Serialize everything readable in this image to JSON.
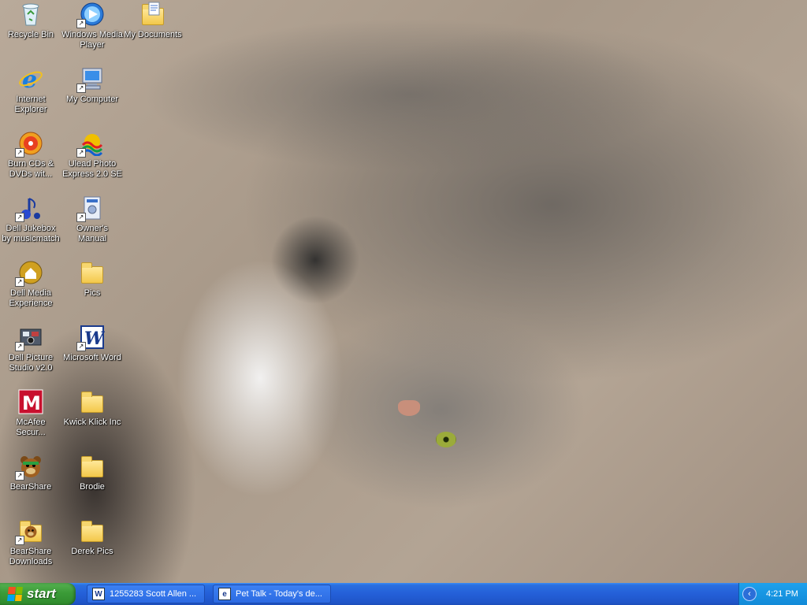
{
  "desktop": {
    "icons": [
      {
        "label": "Recycle Bin",
        "icon": "recycle-bin-icon"
      },
      {
        "label": "Windows Media\nPlayer",
        "icon": "windows-media-player-icon"
      },
      {
        "label": "My Documents",
        "icon": "my-documents-icon"
      },
      {
        "label": "Internet\nExplorer",
        "icon": "internet-explorer-icon"
      },
      {
        "label": "My Computer",
        "icon": "my-computer-icon"
      },
      {
        "label": "Burn CDs &\nDVDs wit...",
        "icon": "burn-cd-icon"
      },
      {
        "label": "Ulead Photo\nExpress 2.0 SE",
        "icon": "ulead-photo-icon"
      },
      {
        "label": "Dell Jukebox\nby musicmatch",
        "icon": "dell-jukebox-icon"
      },
      {
        "label": "Owner's\nManual",
        "icon": "owners-manual-icon"
      },
      {
        "label": "Dell Media\nExperience",
        "icon": "dell-media-icon"
      },
      {
        "label": "Pics",
        "icon": "folder-icon"
      },
      {
        "label": "Dell Picture\nStudio v2.0",
        "icon": "dell-picture-studio-icon"
      },
      {
        "label": "Microsoft Word",
        "icon": "microsoft-word-icon"
      },
      {
        "label": "McAfee\nSecur...",
        "icon": "mcafee-icon"
      },
      {
        "label": "Kwick Klick Inc",
        "icon": "folder-icon"
      },
      {
        "label": "BearShare",
        "icon": "bearshare-icon"
      },
      {
        "label": "Brodie",
        "icon": "folder-icon"
      },
      {
        "label": "BearShare\nDownloads",
        "icon": "bearshare-downloads-icon"
      },
      {
        "label": "Derek Pics",
        "icon": "folder-icon"
      }
    ]
  },
  "taskbar": {
    "start_label": "start",
    "tasks": [
      {
        "label": "1255283 Scott Allen ...",
        "icon": "word-document-icon"
      },
      {
        "label": "Pet Talk - Today's de...",
        "icon": "internet-explorer-icon"
      }
    ],
    "clock": "4:21 PM"
  },
  "colors": {
    "taskbar_blue": "#245fd8",
    "start_green": "#3b9b37",
    "tray_blue": "#128ad8"
  }
}
